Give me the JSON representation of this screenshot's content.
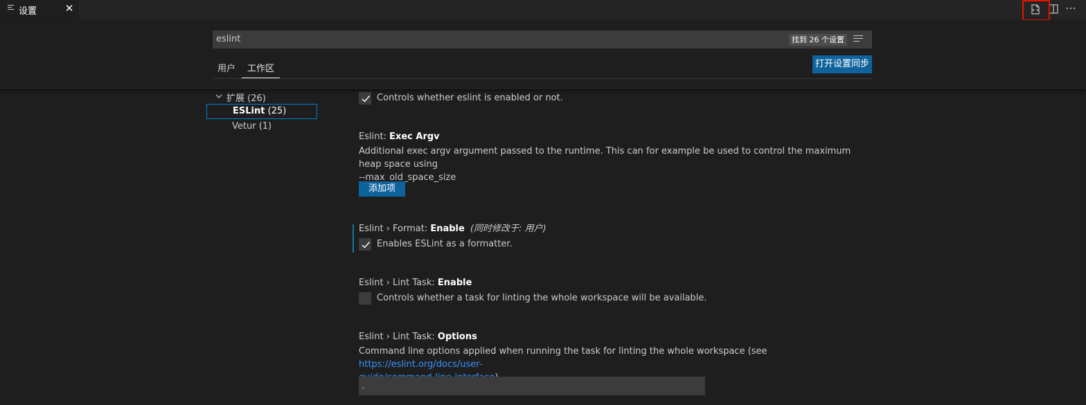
{
  "tab": {
    "label": "设置",
    "close_glyph": "✕",
    "icon": "preferences-list-icon"
  },
  "actions": {
    "open_json": "open-settings-json-icon",
    "split": "split-editor-icon",
    "more": "⋯"
  },
  "search": {
    "value": "eslint",
    "count_badge": "找到 26 个设置",
    "clear_icon": "clear-filter-icon"
  },
  "scope_tabs": [
    {
      "label": "用户"
    },
    {
      "label": "工作区"
    }
  ],
  "sync_button": "打开设置同步",
  "toc": {
    "group": {
      "label": "扩展 (26)",
      "chevron": "chevron-down-icon"
    },
    "items": [
      {
        "name": "ESLint",
        "count": "(25)"
      },
      {
        "label": "Vetur (1)"
      }
    ]
  },
  "settings": {
    "eslint_enable": {
      "description": "Controls whether eslint is enabled or not.",
      "checked": true
    },
    "exec_argv": {
      "category": "Eslint: ",
      "name": "Exec Argv",
      "description_line1": "Additional exec argv argument passed to the runtime. This can for example be used to control the maximum heap space using",
      "description_line2": "--max_old_space_size",
      "add_button": "添加项"
    },
    "format_enable": {
      "category": "Eslint › Format: ",
      "name": "Enable",
      "modified_note": "(同时修改于: 用户)",
      "description": "Enables ESLint as a formatter.",
      "checked": true
    },
    "lint_task_enable": {
      "category": "Eslint › Lint Task: ",
      "name": "Enable",
      "description": "Controls whether a task for linting the whole workspace will be available.",
      "checked": false
    },
    "lint_task_options": {
      "category": "Eslint › Lint Task: ",
      "name": "Options",
      "description_prefix": "Command line options applied when running the task for linting the whole workspace (see ",
      "link_line1": "https://eslint.org/docs/user-",
      "link_line2": "guide/command-line-interface",
      "description_suffix": ").",
      "value": "."
    }
  },
  "colors": {
    "accent": "#0e639c",
    "link": "#3794ff",
    "highlight": "#e51400"
  }
}
